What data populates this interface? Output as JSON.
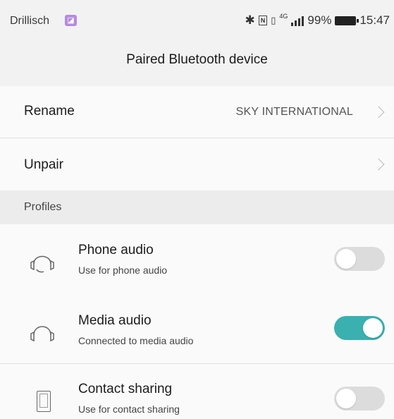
{
  "status_bar": {
    "carrier": "Drillisch",
    "network": "4G",
    "battery": "99%",
    "time": "15:47",
    "icons": [
      "bluetooth-icon",
      "nfc-icon",
      "vibrate-icon",
      "signal-icon",
      "battery-icon"
    ]
  },
  "header": {
    "title": "Paired Bluetooth device"
  },
  "settings": {
    "rename_label": "Rename",
    "device_name": "SKY INTERNATIONAL",
    "unpair_label": "Unpair"
  },
  "profiles": {
    "header": "Profiles",
    "items": [
      {
        "title": "Phone audio",
        "subtitle": "Use for phone audio",
        "icon": "headset-icon",
        "enabled": false
      },
      {
        "title": "Media audio",
        "subtitle": "Connected to media audio",
        "icon": "headphones-icon",
        "enabled": true
      },
      {
        "title": "Contact sharing",
        "subtitle": "Use for contact sharing",
        "icon": "phone-icon",
        "enabled": false
      }
    ]
  },
  "colors": {
    "accent": "#3ab0b0",
    "toggle_off": "#dcdcdc",
    "background": "#f2f2f2"
  }
}
